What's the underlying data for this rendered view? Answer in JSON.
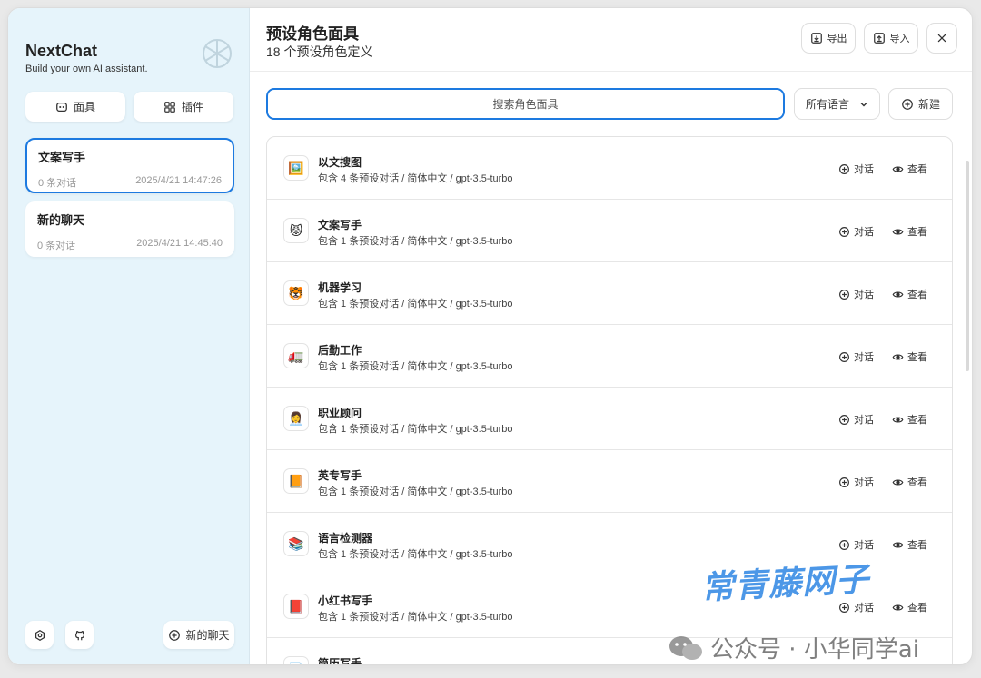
{
  "sidebar": {
    "brand_title": "NextChat",
    "brand_subtitle": "Build your own AI assistant.",
    "mask_button": "面具",
    "plugin_button": "插件",
    "chats": [
      {
        "title": "文案写手",
        "count": "0 条对话",
        "time": "2025/4/21 14:47:26",
        "active": true
      },
      {
        "title": "新的聊天",
        "count": "0 条对话",
        "time": "2025/4/21 14:45:40",
        "active": false
      }
    ],
    "new_chat_button": "新的聊天"
  },
  "header": {
    "title": "预设角色面具",
    "subtitle": "18 个预设角色定义",
    "export_button": "导出",
    "import_button": "导入"
  },
  "toolbar": {
    "search_placeholder": "搜索角色面具",
    "language_select": "所有语言",
    "new_button": "新建"
  },
  "masks": [
    {
      "name": "以文搜图",
      "info": "包含 4 条预设对话 / 简体中文 / gpt-3.5-turbo",
      "emoji": "🖼️"
    },
    {
      "name": "文案写手",
      "info": "包含 1 条预设对话 / 简体中文 / gpt-3.5-turbo",
      "emoji": "😾"
    },
    {
      "name": "机器学习",
      "info": "包含 1 条预设对话 / 简体中文 / gpt-3.5-turbo",
      "emoji": "🐯"
    },
    {
      "name": "后勤工作",
      "info": "包含 1 条预设对话 / 简体中文 / gpt-3.5-turbo",
      "emoji": "🚛"
    },
    {
      "name": "职业顾问",
      "info": "包含 1 条预设对话 / 简体中文 / gpt-3.5-turbo",
      "emoji": "👩‍💼"
    },
    {
      "name": "英专写手",
      "info": "包含 1 条预设对话 / 简体中文 / gpt-3.5-turbo",
      "emoji": "📙"
    },
    {
      "name": "语言检测器",
      "info": "包含 1 条预设对话 / 简体中文 / gpt-3.5-turbo",
      "emoji": "📚"
    },
    {
      "name": "小红书写手",
      "info": "包含 1 条预设对话 / 简体中文 / gpt-3.5-turbo",
      "emoji": "📕"
    },
    {
      "name": "简历写手",
      "info": "",
      "emoji": "📑"
    }
  ],
  "row_actions": {
    "chat": "对话",
    "view": "查看"
  },
  "watermark": {
    "big": "常青藤网子",
    "small": "公众号 · 小华同学ai"
  },
  "colors": {
    "accent": "#1d7ae0",
    "sidebar_bg": "#e6f4fb"
  }
}
